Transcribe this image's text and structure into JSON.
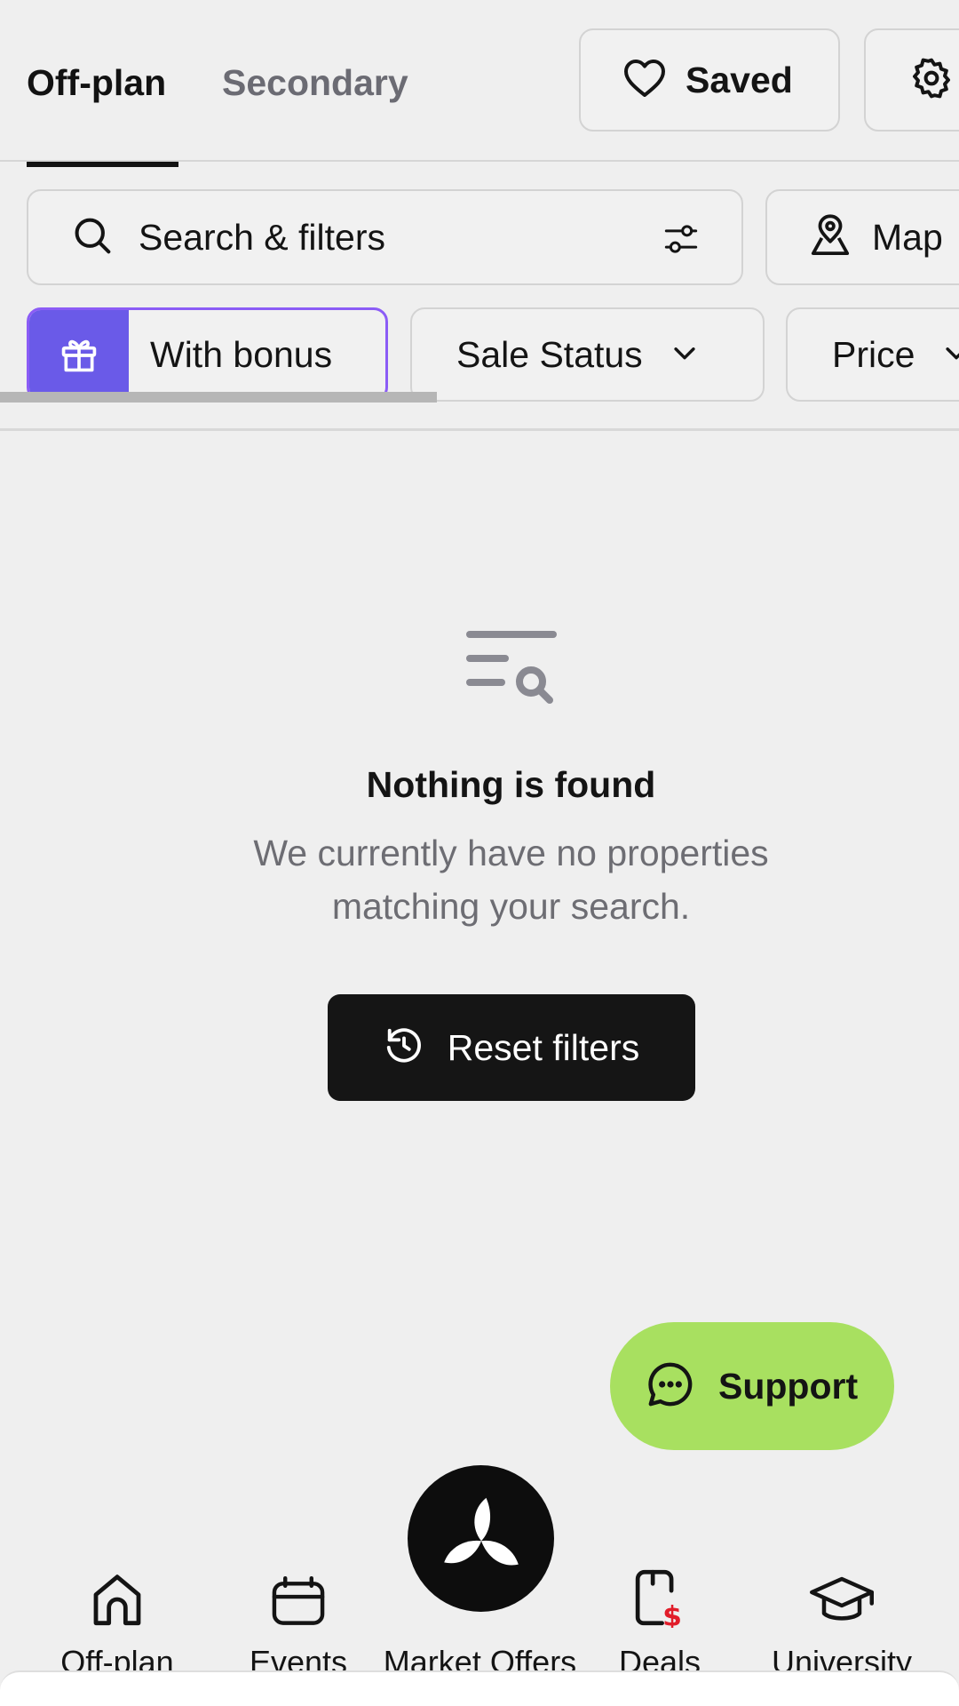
{
  "header": {
    "tabs": [
      {
        "label": "Off-plan",
        "active": true
      },
      {
        "label": "Secondary",
        "active": false
      }
    ],
    "saved_label": "Saved"
  },
  "search": {
    "placeholder": "Search & filters",
    "map_label": "Map"
  },
  "chips": {
    "bonus_label": "With bonus",
    "sale_status_label": "Sale Status",
    "price_label": "Price"
  },
  "empty_state": {
    "title": "Nothing is found",
    "line1": "We currently have no properties",
    "line2": "matching your search.",
    "reset_label": "Reset filters"
  },
  "support": {
    "label": "Support",
    "color": "#a8e060"
  },
  "bottom_nav": {
    "items": [
      {
        "label": "Off-plan",
        "icon": "home-icon"
      },
      {
        "label": "Events",
        "icon": "calendar-icon"
      },
      {
        "label": "Market Offers",
        "icon": "market-offers-logo"
      },
      {
        "label": "Deals",
        "icon": "deals-icon"
      },
      {
        "label": "University",
        "icon": "graduation-cap-icon"
      }
    ]
  },
  "colors": {
    "accent": "#6a5ae8",
    "bonus_border": "#8b5cf6",
    "deals_badge": "#e11d2a",
    "background": "#efefef"
  }
}
